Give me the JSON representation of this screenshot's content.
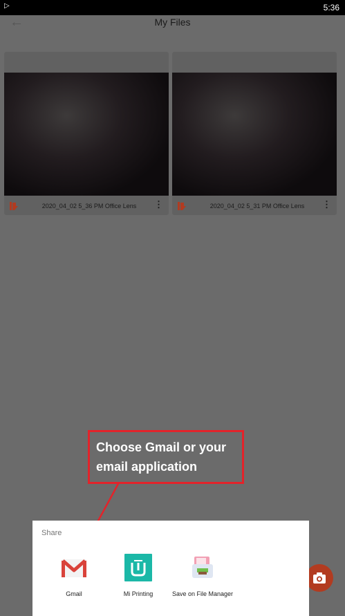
{
  "status_bar": {
    "time": "5:36"
  },
  "app_bar": {
    "title": "My Files"
  },
  "files": [
    {
      "name": "2020_04_02 5_36 PM Office Lens"
    },
    {
      "name": "2020_04_02 5_31 PM Office Lens"
    }
  ],
  "callout": {
    "text": "Choose Gmail or your email application"
  },
  "share": {
    "title": "Share",
    "options": [
      {
        "label": "Gmail",
        "icon": "gmail-icon"
      },
      {
        "label": "Mi Printing",
        "icon": "mi-printing-icon"
      },
      {
        "label": "Save on File Manager",
        "icon": "file-manager-icon"
      }
    ]
  },
  "fab": {
    "icon": "camera-icon"
  },
  "colors": {
    "callout_border": "#e3232a",
    "fab": "#b23b20",
    "mi_teal": "#1bb8a7",
    "gmail_red": "#d9423a"
  }
}
